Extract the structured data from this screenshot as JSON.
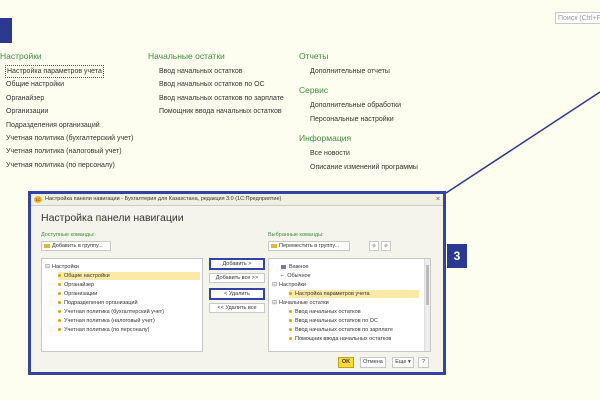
{
  "callouts": {
    "top": "",
    "dialog": "3"
  },
  "search": {
    "placeholder": "Поиск (Ctrl+F)"
  },
  "col1": {
    "title": "Настройки",
    "items": [
      "Настройка параметров учета",
      "Общие настройки",
      "Органайзер",
      "Организации",
      "Подразделения организаций",
      "Учетная политика (бухгалтерский учет)",
      "Учетная политика (налоговый учет)",
      "Учетная политика (по персоналу)"
    ]
  },
  "col2": {
    "title": "Начальные остатки",
    "items": [
      "Ввод начальных остатков",
      "Ввод начальных остатков по ОС",
      "Ввод начальных остатков по зарплате",
      "Помощник ввода начальных остатков"
    ]
  },
  "col3": {
    "reports_title": "Отчеты",
    "reports_items": [
      "Дополнительные отчеты"
    ],
    "service_title": "Сервис",
    "service_items": [
      "Дополнительные обработки",
      "Персональные настройки"
    ],
    "info_title": "Информация",
    "info_items": [
      "Все новости",
      "Описание изменений программы"
    ]
  },
  "dialog": {
    "window_title": "Настройка панели навигации - Бухгалтерия для Казахстана, редакция 3.0  (1С:Предприятие)",
    "close": "×",
    "heading": "Настройка панели навигации",
    "available_label": "Доступные команды:",
    "add_to_group": "Добавить в группу...",
    "selected_label": "Выбранные команды:",
    "move_to_group": "Переместить в группу...",
    "add": "Добавить >",
    "add_all": "Добавить все >>",
    "remove": "< Удалить",
    "remove_all": "<< Удалить все",
    "left_tree": {
      "root": "Настройки",
      "items": [
        "Общие настройки",
        "Органайзер",
        "Организации",
        "Подразделения организаций",
        "Учетная политика (бухгалтерский учет)",
        "Учетная политика (налоговый учет)",
        "Учетная политика (по персоналу)"
      ]
    },
    "right_tree": {
      "important": "Важное",
      "ordinary": "Обычное",
      "settings": "Настройки",
      "settings_item": "Настройка параметров учета",
      "opening": "Начальные остатки",
      "opening_items": [
        "Ввод начальных остатков",
        "Ввод начальных остатков по ОС",
        "Ввод начальных остатков по зарплате",
        "Помощник ввода начальных остатков"
      ]
    },
    "ok": "OK",
    "cancel": "Отмена",
    "more": "Еще ▾",
    "help": "?"
  }
}
